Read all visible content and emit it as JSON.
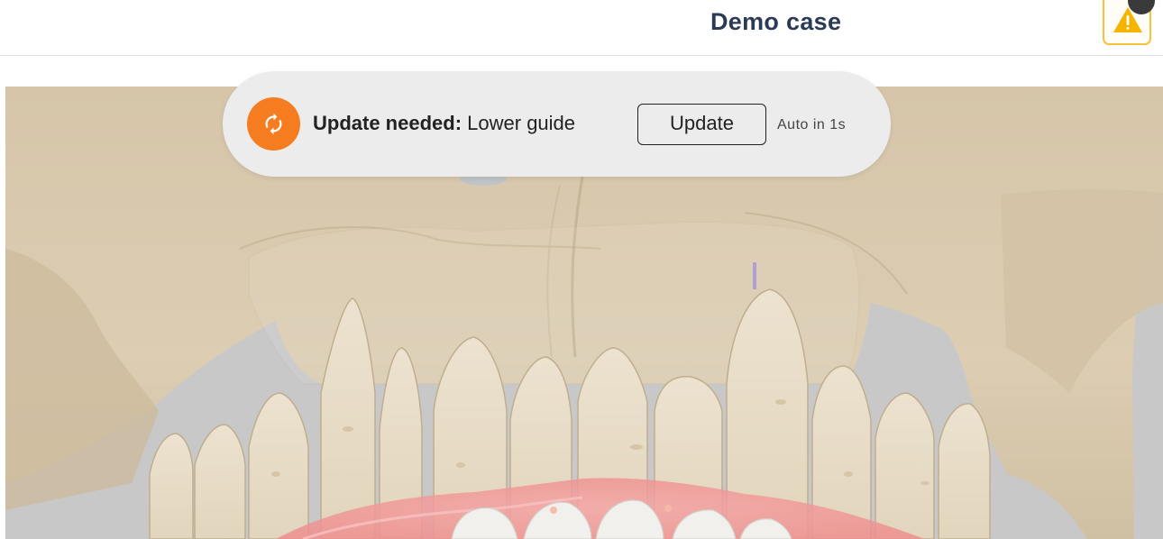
{
  "header": {
    "title": "Demo case",
    "warning_icon": "warning-triangle-icon"
  },
  "toast": {
    "icon": "sync-icon",
    "label_strong": "Update needed:",
    "label_item": "Lower guide",
    "button_label": "Update",
    "auto_text": "Auto in 1s"
  },
  "colors": {
    "title": "#2b3a55",
    "warning_accent": "#f5c33b",
    "toast_icon_bg": "#f57c1f",
    "bone": "#d9c8ac",
    "guide_overlay": "#f29a9a"
  }
}
